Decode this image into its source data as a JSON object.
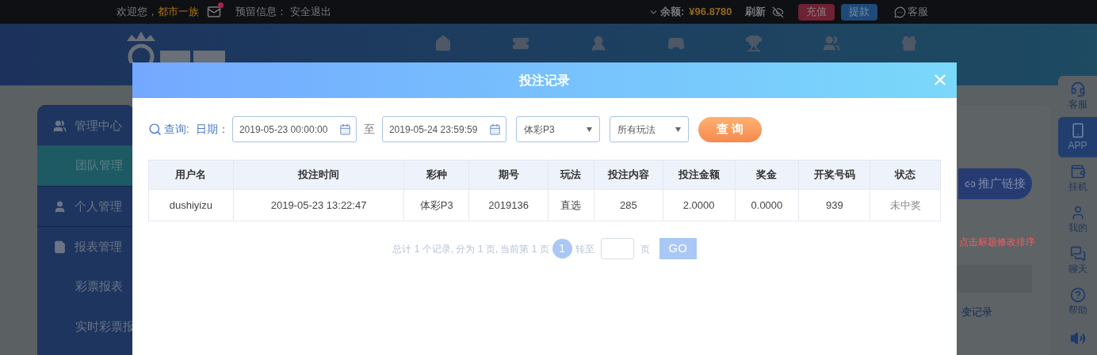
{
  "top_bar": {
    "welcome": "欢迎您，",
    "username": "都市一族",
    "mail_unread": true,
    "reserved_info": "预留信息：",
    "logout": "安全退出",
    "balance_label": "余额:",
    "balance": "¥96.8780",
    "refresh": "刷新",
    "deposit": "充值",
    "withdraw": "提款",
    "support": "客服"
  },
  "sidebar": {
    "items": [
      {
        "label": "管理中心",
        "kind": "heading",
        "selected": false
      },
      {
        "label": "团队管理",
        "kind": "sub",
        "selected": true
      },
      {
        "label": "个人管理",
        "kind": "heading",
        "selected": false
      },
      {
        "label": "报表管理",
        "kind": "heading",
        "selected": false
      },
      {
        "label": "彩票报表",
        "kind": "sub",
        "selected": false
      },
      {
        "label": "实时彩票报",
        "kind": "sub",
        "selected": false
      }
    ]
  },
  "content": {
    "promo_button": "推广链接",
    "sort_hint": "点击标题修改排序",
    "record_link": "变记录"
  },
  "right_rail": {
    "items": [
      {
        "label": "客服",
        "selected": false
      },
      {
        "label": "APP",
        "selected": true
      },
      {
        "label": "挂机",
        "selected": false
      },
      {
        "label": "我的",
        "selected": false
      },
      {
        "label": "聊天",
        "selected": false
      },
      {
        "label": "帮助",
        "selected": false
      }
    ]
  },
  "modal": {
    "title": "投注记录",
    "filters": {
      "query_label": "查询:",
      "date_label": "日期：",
      "start_date": "2019-05-23 00:00:00",
      "to": "至",
      "end_date": "2019-05-24 23:59:59",
      "lottery": "体彩P3",
      "play_type": "所有玩法",
      "search_button": "查 询"
    },
    "table": {
      "columns": [
        "用户名",
        "投注时间",
        "彩种",
        "期号",
        "玩法",
        "投注内容",
        "投注金额",
        "奖金",
        "开奖号码",
        "状态"
      ],
      "rows": [
        [
          "dushiyizu",
          "2019-05-23 13:22:47",
          "体彩P3",
          "2019136",
          "直选",
          "285",
          "2.0000",
          "0.0000",
          "939",
          "未中奖"
        ]
      ]
    },
    "pagination": {
      "summary": "总计 1 个记录, 分为 1 页, 当前第 1 页",
      "pages": [
        {
          "label": "1",
          "selected": true
        }
      ],
      "goto_label": "转至",
      "page_unit": "页",
      "go_button": "GO"
    }
  }
}
